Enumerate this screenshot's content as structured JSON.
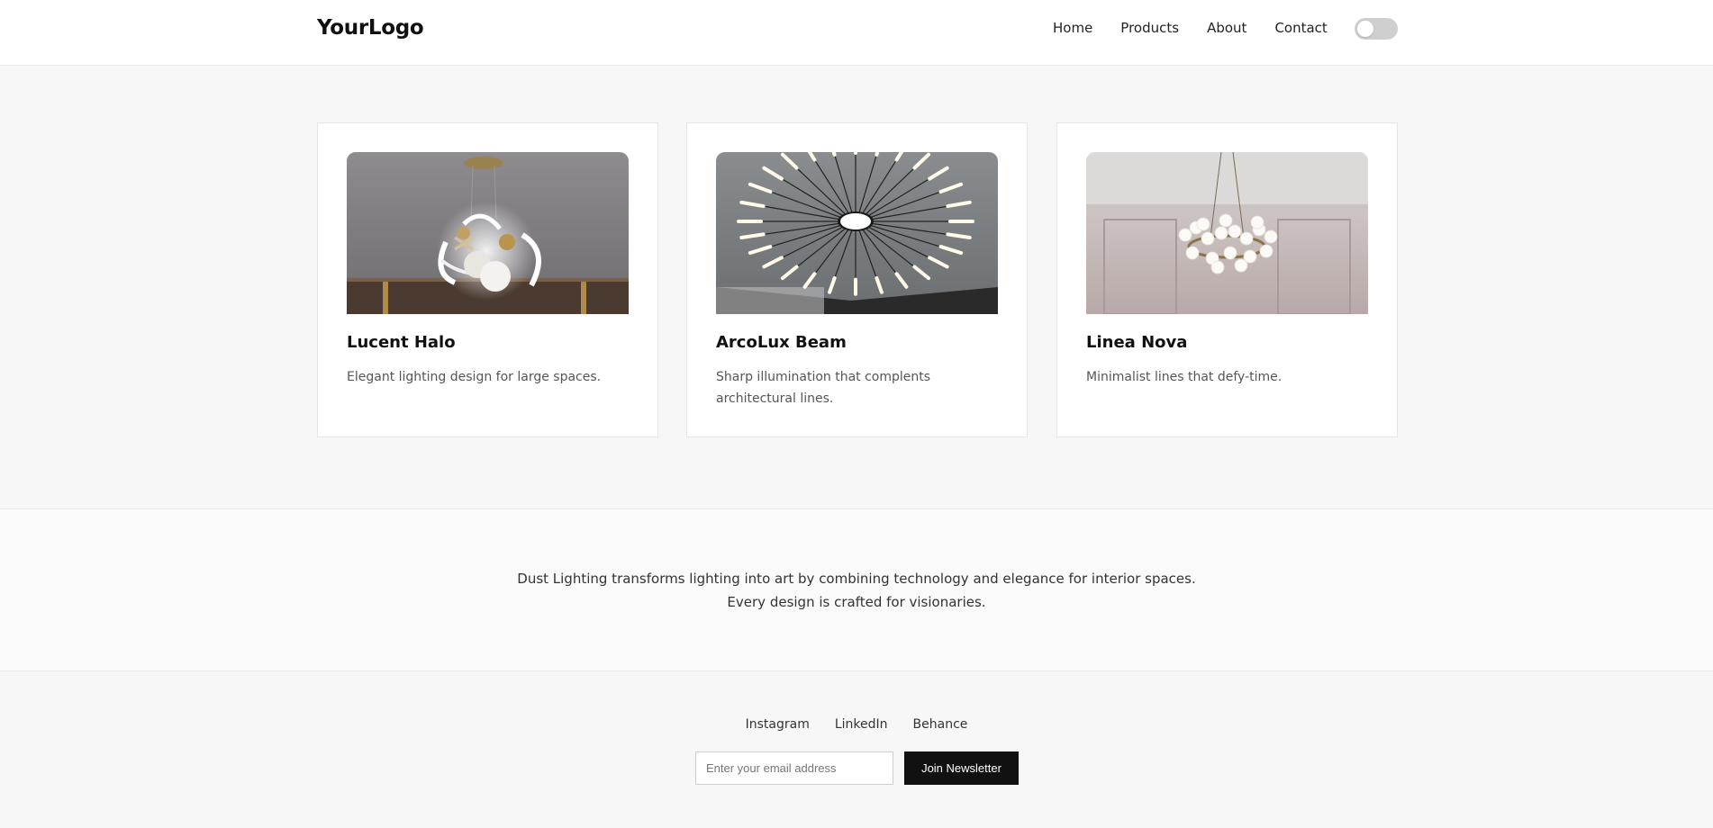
{
  "header": {
    "logo": "YourLogo",
    "nav": [
      "Home",
      "Products",
      "About",
      "Contact"
    ],
    "theme_toggle": {
      "state": "off"
    }
  },
  "products": [
    {
      "name": "Lucent Halo",
      "description": "Elegant lighting design for large spaces."
    },
    {
      "name": "ArcoLux Beam",
      "description": "Sharp illumination that complents architectural lines."
    },
    {
      "name": "Linea Nova",
      "description": "Minimalist lines that defy-time."
    }
  ],
  "about": {
    "line1": "Dust Lighting transforms lighting into art by combining technology and elegance for interior spaces.",
    "line2": "Every design is crafted for visionaries."
  },
  "footer": {
    "social": [
      "Instagram",
      "LinkedIn",
      "Behance"
    ],
    "email_placeholder": "Enter your email address",
    "join_label": "Join Newsletter"
  }
}
